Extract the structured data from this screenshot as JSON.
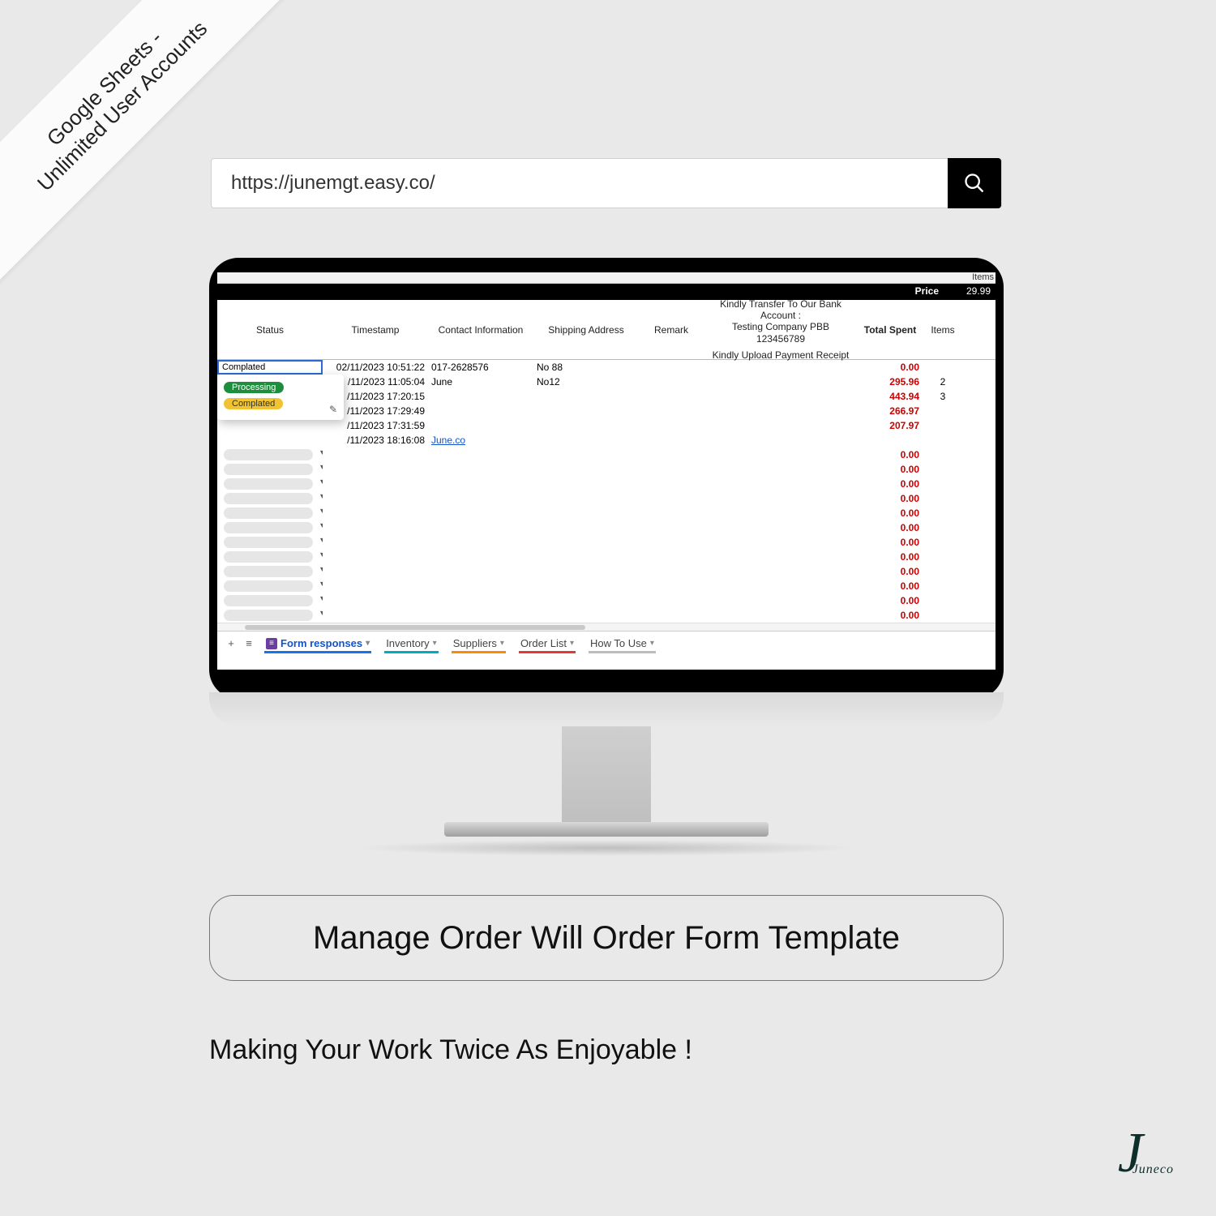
{
  "ribbon": {
    "line1": "Google Sheets -",
    "line2": "Unlimited User Accounts"
  },
  "search": {
    "value": "https://junemgt.easy.co/"
  },
  "top": {
    "items_label": "Items",
    "price_label": "Price",
    "price_value": "29.99"
  },
  "headers": {
    "status": "Status",
    "timestamp": "Timestamp",
    "contact": "Contact Information",
    "shipping": "Shipping Address",
    "remark": "Remark",
    "bank_l1": "Kindly Transfer To Our Bank",
    "bank_l2": "Account :",
    "bank_l3": "Testing Company PBB 123456789",
    "bank_l4": "Kindly Upload Payment Receipt",
    "total_spent": "Total Spent",
    "items": "Items"
  },
  "status_cell": "Complated",
  "status_options": {
    "processing": "Processing",
    "complated": "Complated"
  },
  "rows": [
    {
      "ts": "02/11/2023 10:51:22",
      "contact": "017-2628576",
      "ship": "No 88",
      "spent": "0.00",
      "items": ""
    },
    {
      "ts": "/11/2023 11:05:04",
      "contact": "June",
      "ship": "No12",
      "spent": "295.96",
      "items": "2"
    },
    {
      "ts": "/11/2023 17:20:15",
      "contact": "",
      "ship": "",
      "spent": "443.94",
      "items": "3"
    },
    {
      "ts": "/11/2023 17:29:49",
      "contact": "",
      "ship": "",
      "spent": "266.97",
      "items": ""
    },
    {
      "ts": "/11/2023 17:31:59",
      "contact": "",
      "ship": "",
      "spent": "207.97",
      "items": ""
    },
    {
      "ts": "/11/2023 18:16:08",
      "contact": "June.co",
      "ship": "",
      "spent": "",
      "items": "",
      "link": true
    }
  ],
  "zero": "0.00",
  "tabs": {
    "form": "Form responses",
    "inventory": "Inventory",
    "suppliers": "Suppliers",
    "orderlist": "Order List",
    "howto": "How To Use"
  },
  "headline": "Manage Order Will Order Form Template",
  "tagline": "Making Your Work Twice As Enjoyable !",
  "logo": {
    "big": "J",
    "small": "Juneco"
  }
}
